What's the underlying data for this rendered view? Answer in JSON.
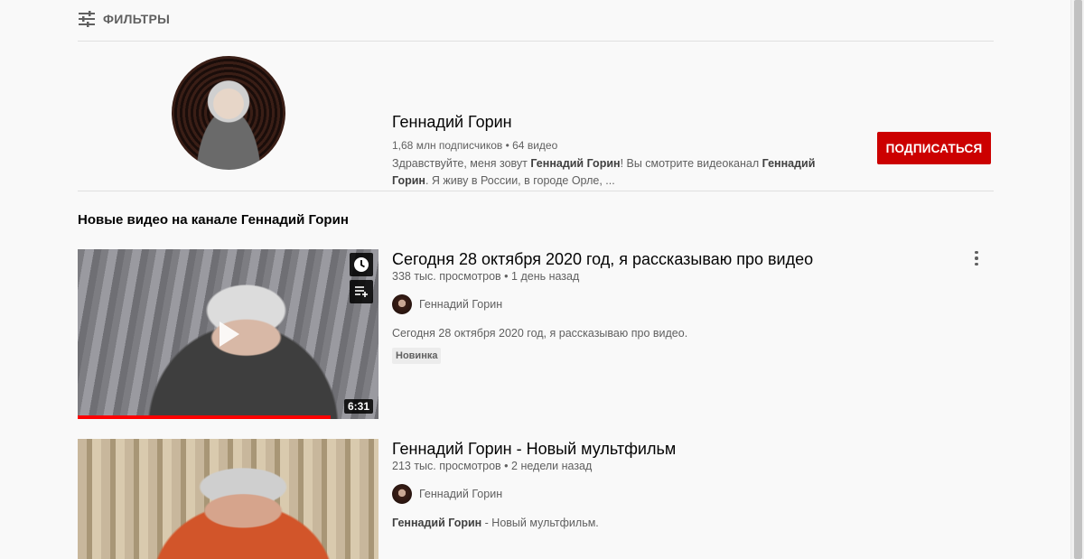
{
  "filters": {
    "label": "ФИЛЬТРЫ",
    "icon": "sliders-icon"
  },
  "channel": {
    "name": "Геннадий Горин",
    "meta": "1,68 млн подписчиков • 64 видео",
    "desc_1": "Здравствуйте, меня зовут ",
    "desc_bold_1": "Геннадий Горин",
    "desc_2": "! Вы смотрите видеоканал ",
    "desc_bold_2": "Геннадий Горин",
    "desc_3": ". Я живу в России, в городе Орле, ...",
    "subscribe_label": "ПОДПИСАТЬСЯ"
  },
  "section_title": "Новые видео на канале Геннадий Горин",
  "videos": [
    {
      "title": "Сегодня 28 октября 2020 год, я рассказываю про видео",
      "meta": "338 тыс. просмотров • 1 день назад",
      "channel": "Геннадий Горин",
      "desc": "Сегодня 28 октября 2020 год, я рассказываю про видео.",
      "badge": "Новинка",
      "duration": "6:31",
      "watched_fraction": 0.84
    },
    {
      "title": "Геннадий Горин - Новый мультфильм",
      "meta": "213 тыс. просмотров • 2 недели назад",
      "channel": "Геннадий Горин",
      "desc_bold": "Геннадий Горин",
      "desc_rest": " - Новый мультфильм."
    }
  ],
  "colors": {
    "subscribe": "#cc0000",
    "progress": "#ff0000",
    "background": "#f9f9f9"
  }
}
